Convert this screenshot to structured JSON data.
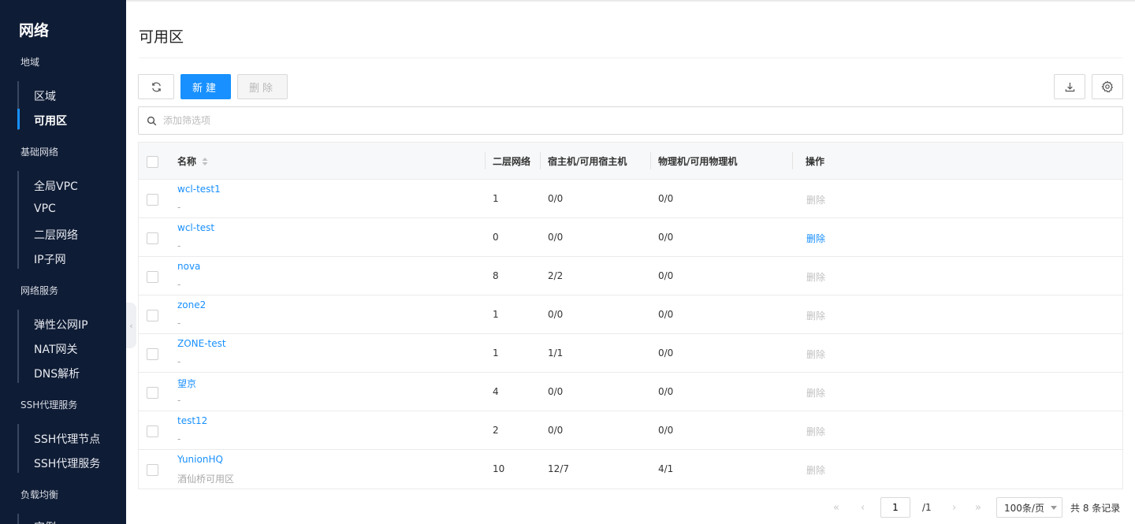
{
  "sidebar": {
    "title": "网络",
    "groups": [
      {
        "label": "地域",
        "items": [
          "区域",
          "可用区"
        ]
      },
      {
        "label": "基础网络",
        "items": [
          "全局VPC",
          "VPC",
          "二层网络",
          "IP子网"
        ]
      },
      {
        "label": "网络服务",
        "items": [
          "弹性公网IP",
          "NAT网关",
          "DNS解析"
        ]
      },
      {
        "label": "SSH代理服务",
        "items": [
          "SSH代理节点",
          "SSH代理服务"
        ]
      },
      {
        "label": "负载均衡",
        "items": [
          "实例"
        ]
      }
    ],
    "active_item": "可用区"
  },
  "page": {
    "title": "可用区"
  },
  "toolbar": {
    "new_label": "新建",
    "delete_label": "删除"
  },
  "filter": {
    "placeholder": "添加筛选项",
    "value": ""
  },
  "table": {
    "columns": [
      "名称",
      "二层网络",
      "宿主机/可用宿主机",
      "物理机/可用物理机",
      "操作"
    ],
    "rows": [
      {
        "name": "wcl-test1",
        "desc": "-",
        "l2": "1",
        "hosts": "0/0",
        "baremetal": "0/0",
        "action": "删除",
        "action_enabled": false
      },
      {
        "name": "wcl-test",
        "desc": "-",
        "l2": "0",
        "hosts": "0/0",
        "baremetal": "0/0",
        "action": "删除",
        "action_enabled": true
      },
      {
        "name": "nova",
        "desc": "-",
        "l2": "8",
        "hosts": "2/2",
        "baremetal": "0/0",
        "action": "删除",
        "action_enabled": false
      },
      {
        "name": "zone2",
        "desc": "-",
        "l2": "1",
        "hosts": "0/0",
        "baremetal": "0/0",
        "action": "删除",
        "action_enabled": false
      },
      {
        "name": "ZONE-test",
        "desc": "-",
        "l2": "1",
        "hosts": "1/1",
        "baremetal": "0/0",
        "action": "删除",
        "action_enabled": false
      },
      {
        "name": "望京",
        "desc": "-",
        "l2": "4",
        "hosts": "0/0",
        "baremetal": "0/0",
        "action": "删除",
        "action_enabled": false
      },
      {
        "name": "test12",
        "desc": "-",
        "l2": "2",
        "hosts": "0/0",
        "baremetal": "0/0",
        "action": "删除",
        "action_enabled": false
      },
      {
        "name": "YunionHQ",
        "desc": "酒仙桥可用区",
        "l2": "10",
        "hosts": "12/7",
        "baremetal": "4/1",
        "action": "删除",
        "action_enabled": false
      }
    ]
  },
  "pagination": {
    "current_page": "1",
    "total_pages": "/1",
    "page_size": "100条/页",
    "total": "共 8 条记录"
  },
  "colors": {
    "sidebar_bg": "#0f1c35",
    "accent": "#1890ff",
    "disabled": "#c0c0c0"
  }
}
